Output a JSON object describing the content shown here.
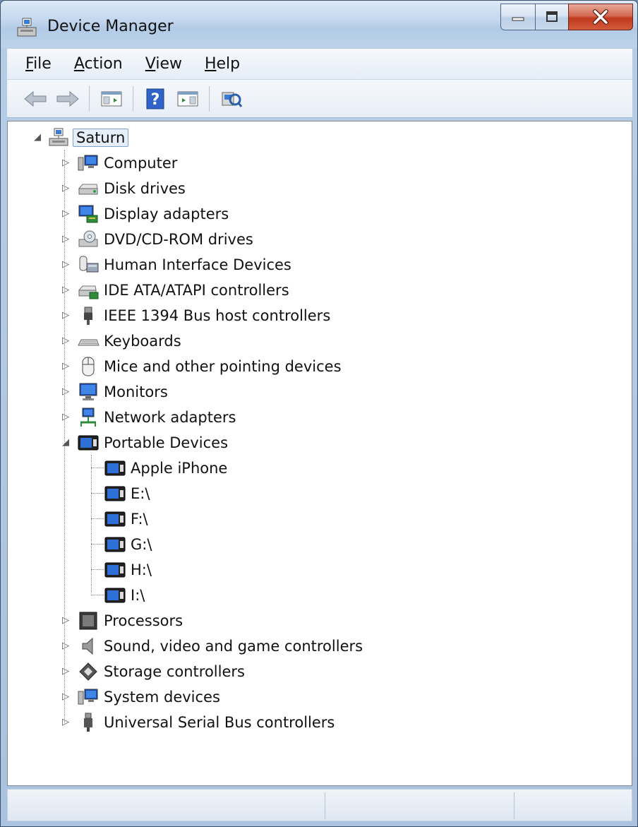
{
  "window": {
    "title": "Device Manager"
  },
  "menu": [
    {
      "label": "File",
      "mnemonic": "F",
      "rest": "ile"
    },
    {
      "label": "Action",
      "mnemonic": "A",
      "rest": "ction"
    },
    {
      "label": "View",
      "mnemonic": "V",
      "rest": "iew"
    },
    {
      "label": "Help",
      "mnemonic": "H",
      "rest": "elp"
    }
  ],
  "toolbar": {
    "buttons": [
      "back-arrow-icon",
      "forward-arrow-icon",
      "show-hide-console-tree-icon",
      "help-icon",
      "show-hide-action-pane-icon",
      "scan-hardware-changes-icon"
    ]
  },
  "tree": {
    "root": {
      "label": "Saturn",
      "expanded": true
    },
    "categories": [
      {
        "label": "Computer",
        "icon": "computer-icon",
        "expanded": false
      },
      {
        "label": "Disk drives",
        "icon": "disk-drive-icon",
        "expanded": false
      },
      {
        "label": "Display adapters",
        "icon": "display-adapter-icon",
        "expanded": false
      },
      {
        "label": "DVD/CD-ROM drives",
        "icon": "dvd-drive-icon",
        "expanded": false
      },
      {
        "label": "Human Interface Devices",
        "icon": "hid-icon",
        "expanded": false
      },
      {
        "label": "IDE ATA/ATAPI controllers",
        "icon": "ide-controller-icon",
        "expanded": false
      },
      {
        "label": "IEEE 1394 Bus host controllers",
        "icon": "ieee1394-icon",
        "expanded": false
      },
      {
        "label": "Keyboards",
        "icon": "keyboard-icon",
        "expanded": false
      },
      {
        "label": "Mice and other pointing devices",
        "icon": "mouse-icon",
        "expanded": false
      },
      {
        "label": "Monitors",
        "icon": "monitor-icon",
        "expanded": false
      },
      {
        "label": "Network adapters",
        "icon": "network-adapter-icon",
        "expanded": false
      },
      {
        "label": "Portable Devices",
        "icon": "portable-device-icon",
        "expanded": true,
        "children": [
          "Apple iPhone",
          "E:\\",
          "F:\\",
          "G:\\",
          "H:\\",
          "I:\\"
        ]
      },
      {
        "label": "Processors",
        "icon": "processor-icon",
        "expanded": false
      },
      {
        "label": "Sound, video and game controllers",
        "icon": "speaker-icon",
        "expanded": false
      },
      {
        "label": "Storage controllers",
        "icon": "storage-controller-icon",
        "expanded": false
      },
      {
        "label": "System devices",
        "icon": "system-device-icon",
        "expanded": false
      },
      {
        "label": "Universal Serial Bus controllers",
        "icon": "usb-icon",
        "expanded": false
      }
    ]
  },
  "colors": {
    "selection_border": "#7da2ce",
    "close_button": "#c0391e"
  }
}
